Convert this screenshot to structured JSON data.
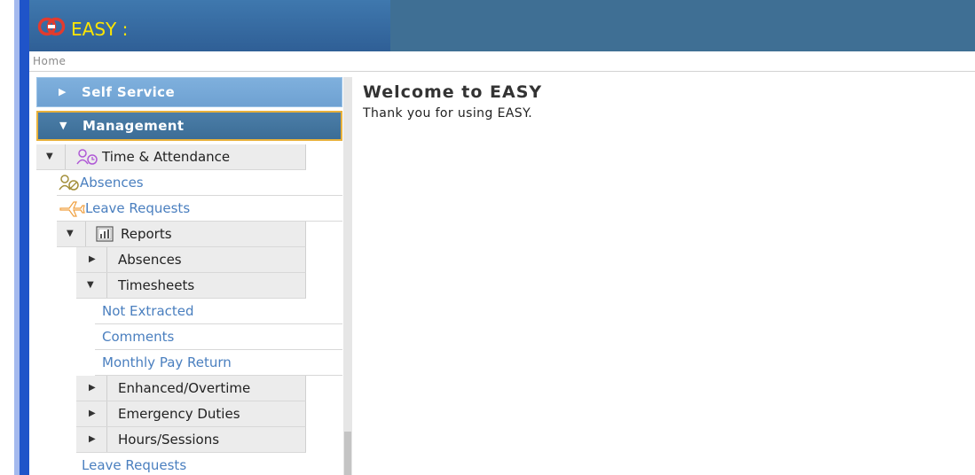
{
  "header": {
    "app_title": "EASY :"
  },
  "breadcrumb": "Home",
  "sidebar": {
    "self_service": "Self Service",
    "management": "Management",
    "time_attendance": "Time & Attendance",
    "absences": "Absences",
    "leave_requests": "Leave Requests",
    "reports": "Reports",
    "reports_absences": "Absences",
    "timesheets": "Timesheets",
    "not_extracted": "Not Extracted",
    "comments": "Comments",
    "monthly_pay_return": "Monthly Pay Return",
    "enhanced_overtime": "Enhanced/Overtime",
    "emergency_duties": "Emergency Duties",
    "hours_sessions": "Hours/Sessions",
    "leave_requests_bottom": "Leave Requests"
  },
  "main": {
    "welcome": "Welcome to EASY",
    "thanks": "Thank you for using EASY."
  },
  "colors": {
    "header": "#3f6f94",
    "title": "#ffe600",
    "link": "#4a7fbf",
    "highlight": "#e8b13b"
  }
}
